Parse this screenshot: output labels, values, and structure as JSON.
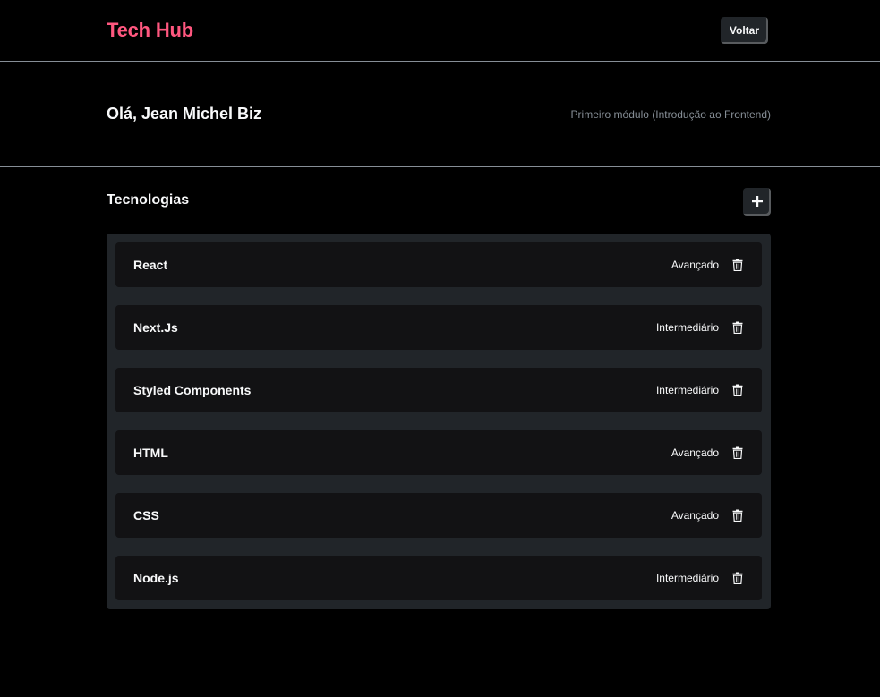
{
  "header": {
    "logo": "Tech Hub",
    "back_label": "Voltar"
  },
  "greeting": {
    "name": "Olá, Jean Michel Biz",
    "module": "Primeiro módulo (Introdução ao Frontend)"
  },
  "techs": {
    "title": "Tecnologias",
    "add_icon": "plus-icon",
    "delete_icon": "trash-icon",
    "items": [
      {
        "name": "React",
        "status": "Avançado"
      },
      {
        "name": "Next.Js",
        "status": "Intermediário"
      },
      {
        "name": "Styled Components",
        "status": "Intermediário"
      },
      {
        "name": "HTML",
        "status": "Avançado"
      },
      {
        "name": "CSS",
        "status": "Avançado"
      },
      {
        "name": "Node.js",
        "status": "Intermediário"
      }
    ]
  },
  "colors": {
    "brand": "#FF577F",
    "background": "#000000",
    "list_background": "#212529",
    "card_background": "#121214",
    "muted_text": "#868E96"
  }
}
